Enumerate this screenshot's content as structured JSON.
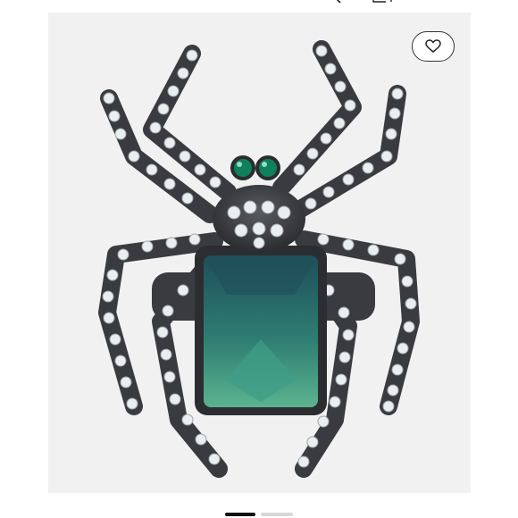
{
  "topbar": {
    "icons": [
      "search-icon",
      "cart-icon"
    ]
  },
  "product": {
    "image_description_icon": "spider-ring-image",
    "background": "#f1f1f1",
    "gem_color": "#2f8a7a",
    "eye_color": "#0f7f5c",
    "metal_color": "#3a3b40"
  },
  "favorite": {
    "icon": "heart-icon"
  },
  "pager": {
    "total": 2,
    "active": 1
  }
}
